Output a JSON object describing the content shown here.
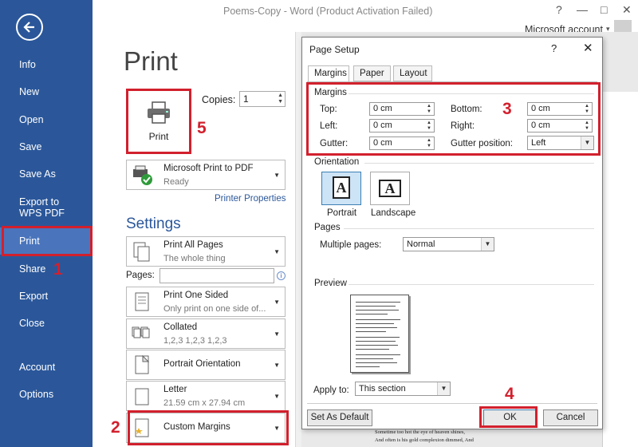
{
  "window": {
    "title": "Poems-Copy - Word (Product Activation Failed)",
    "help_glyph": "?",
    "minimize_glyph": "—",
    "restore_glyph": "□",
    "close_glyph": "✕",
    "account_label": "Microsoft account",
    "account_caret": "▾"
  },
  "sidebar": {
    "items": [
      {
        "label": "Info"
      },
      {
        "label": "New"
      },
      {
        "label": "Open"
      },
      {
        "label": "Save"
      },
      {
        "label": "Save As"
      },
      {
        "label": "Export to WPS PDF"
      },
      {
        "label": "Print"
      },
      {
        "label": "Share"
      },
      {
        "label": "Export"
      },
      {
        "label": "Close"
      },
      {
        "label": "Account"
      },
      {
        "label": "Options"
      }
    ],
    "active": "Print",
    "accent_color": "#2b579a"
  },
  "print": {
    "heading": "Print",
    "print_button_label": "Print",
    "copies_label": "Copies:",
    "copies_value": "1",
    "printer": {
      "name": "Microsoft Print to PDF",
      "status": "Ready"
    },
    "printer_properties": "Printer Properties",
    "settings_heading": "Settings",
    "pages_label": "Pages:",
    "pages_value": "",
    "info_glyph": "i",
    "settings": [
      {
        "main": "Print All Pages",
        "sub": "The whole thing"
      },
      {
        "main": "Print One Sided",
        "sub": "Only print on one side of..."
      },
      {
        "main": "Collated",
        "sub": "1,2,3    1,2,3    1,2,3"
      },
      {
        "main": "Portrait Orientation",
        "sub": ""
      },
      {
        "main": "Letter",
        "sub": "21.59 cm x 27.94 cm"
      },
      {
        "main": "Custom Margins",
        "sub": ""
      }
    ]
  },
  "annotations": {
    "step1": "1",
    "step2": "2",
    "step3": "3",
    "step4": "4",
    "step5": "5",
    "color": "#d2202d"
  },
  "dialog": {
    "title": "Page Setup",
    "help": "?",
    "close": "✕",
    "tabs": [
      "Margins",
      "Paper",
      "Layout"
    ],
    "active_tab": "Margins",
    "margins_group": "Margins",
    "top_label": "Top:",
    "top_value": "0 cm",
    "bottom_label": "Bottom:",
    "bottom_value": "0 cm",
    "left_label": "Left:",
    "left_value": "0 cm",
    "right_label": "Right:",
    "right_value": "0 cm",
    "gutter_label": "Gutter:",
    "gutter_value": "0 cm",
    "gutter_pos_label": "Gutter position:",
    "gutter_pos_value": "Left",
    "orientation_group": "Orientation",
    "portrait_label": "Portrait",
    "landscape_label": "Landscape",
    "orientation_glyph": "A",
    "pages_group": "Pages",
    "multiple_pages_label": "Multiple pages:",
    "multiple_pages_value": "Normal",
    "preview_group": "Preview",
    "apply_to_label": "Apply to:",
    "apply_to_value": "This section",
    "set_default": "Set As Default",
    "ok": "OK",
    "cancel": "Cancel"
  },
  "document_snippet": [
    "Sometime too hot the eye of heaven shines,",
    "And often is his gold complexion dimmed, And"
  ]
}
